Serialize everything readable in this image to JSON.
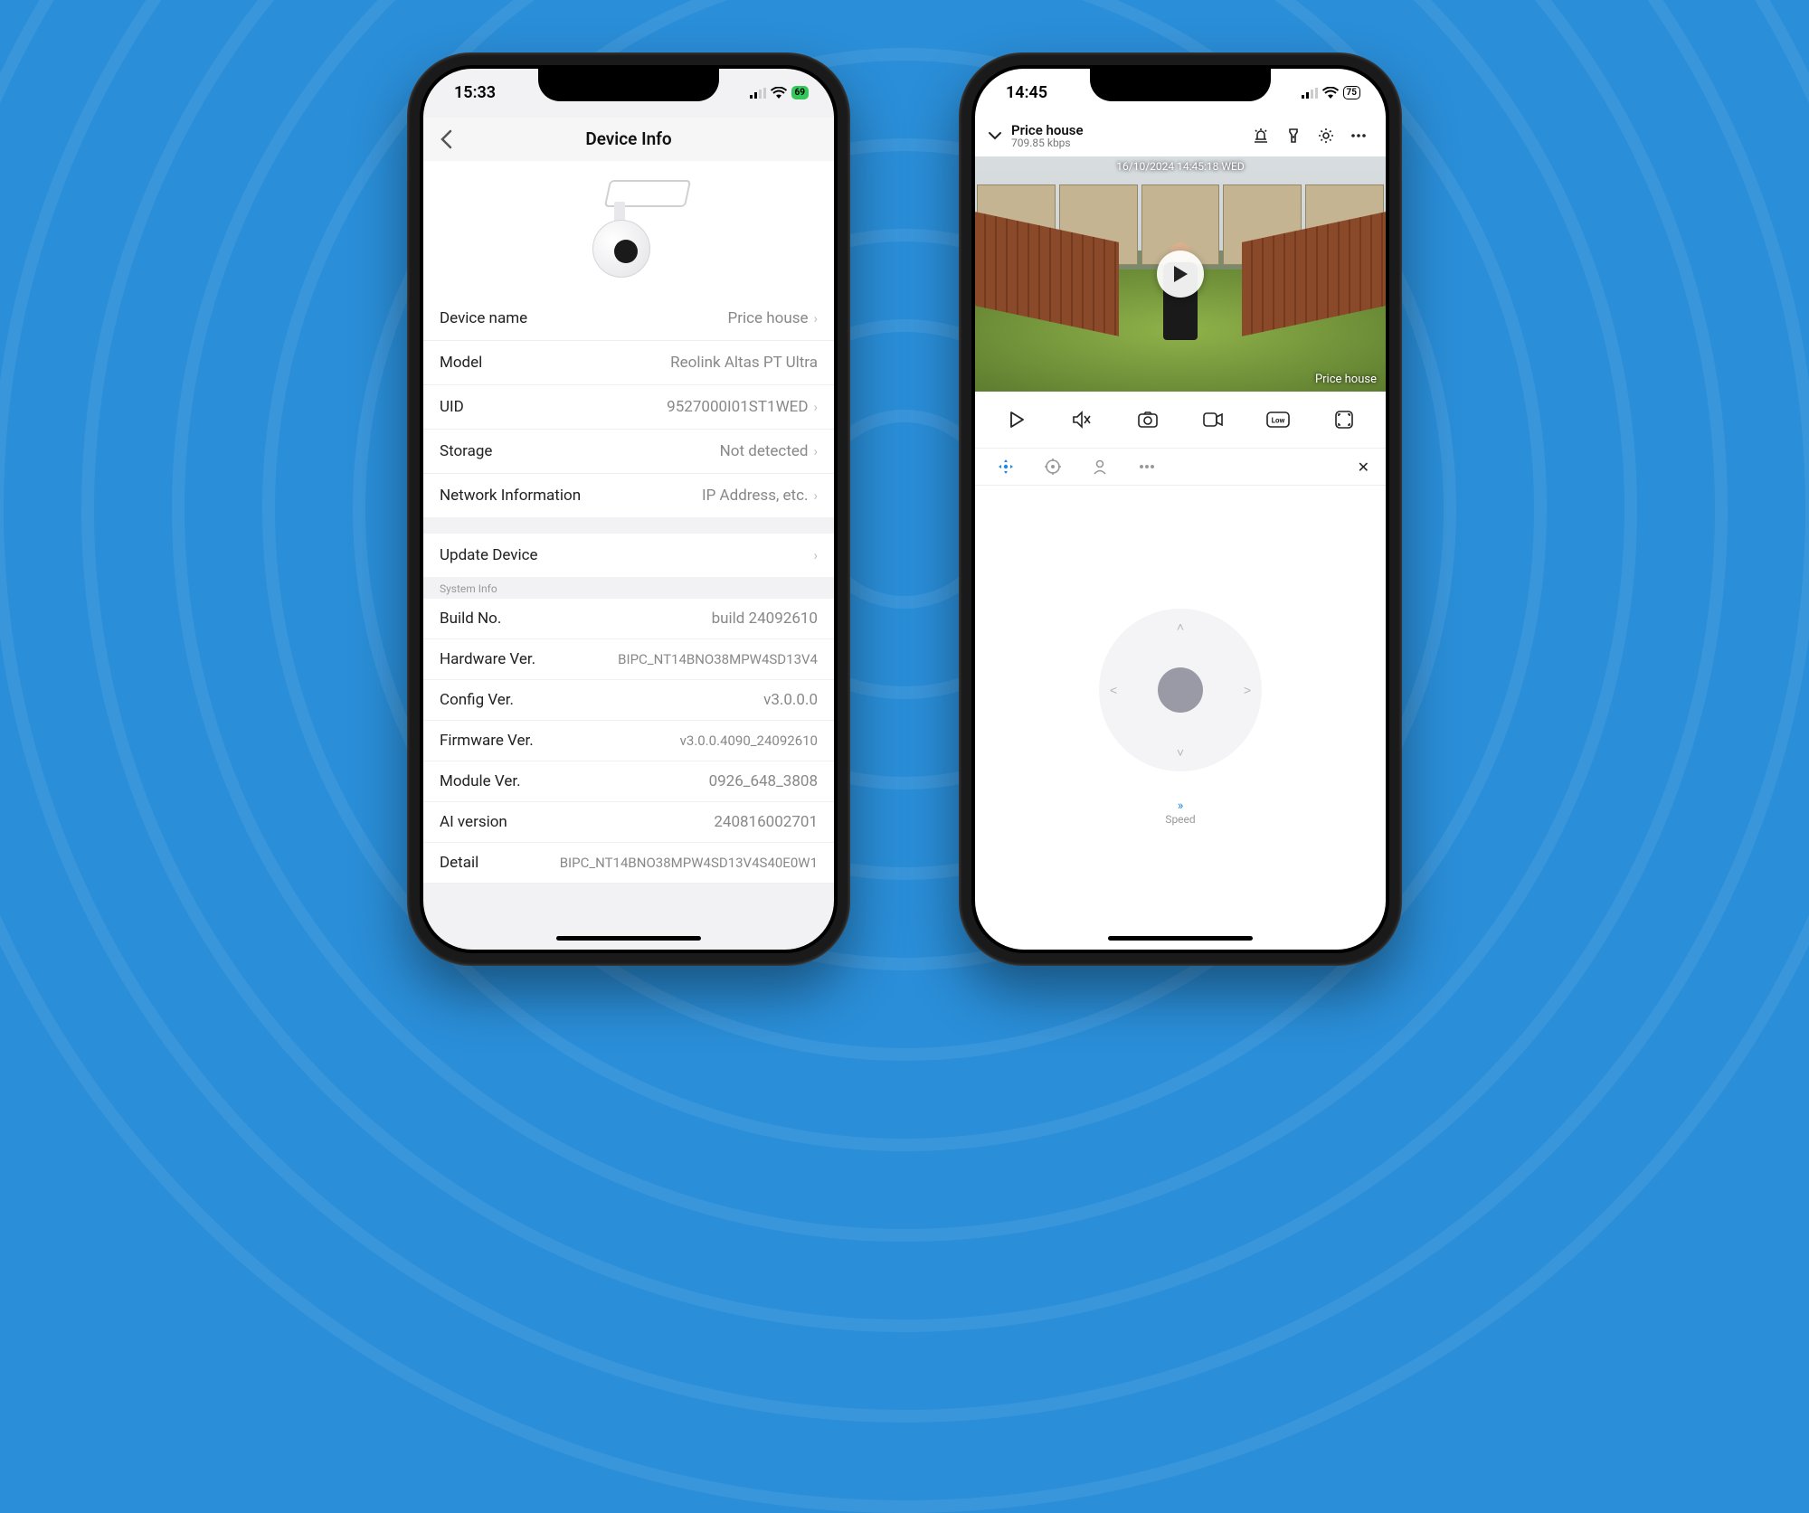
{
  "left": {
    "status": {
      "time": "15:33",
      "battery": "69"
    },
    "title": "Device Info",
    "rows": [
      {
        "label": "Device name",
        "value": "Price house"
      },
      {
        "label": "Model",
        "value": "Reolink Altas PT Ultra"
      },
      {
        "label": "UID",
        "value": "9527000I01ST1WED"
      },
      {
        "label": "Storage",
        "value": "Not detected"
      },
      {
        "label": "Network Information",
        "value": "IP Address, etc."
      }
    ],
    "update": {
      "label": "Update Device"
    },
    "system_header": "System Info",
    "system": [
      {
        "label": "Build No.",
        "value": "build 24092610"
      },
      {
        "label": "Hardware Ver.",
        "value": "BIPC_NT14BNO38MPW4SD13V4"
      },
      {
        "label": "Config Ver.",
        "value": "v3.0.0.0"
      },
      {
        "label": "Firmware Ver.",
        "value": "v3.0.0.4090_24092610"
      },
      {
        "label": "Module Ver.",
        "value": "0926_648_3808"
      },
      {
        "label": "AI version",
        "value": "240816002701"
      },
      {
        "label": "Detail",
        "value": "BIPC_NT14BNO38MPW4SD13V4S40E0W1"
      }
    ]
  },
  "right": {
    "status": {
      "time": "14:45",
      "battery": "75"
    },
    "camera_name": "Price house",
    "bitrate": "709.85 kbps",
    "overlay_timestamp": "16/10/2024 14:45:18 WED",
    "overlay_name": "Price house",
    "speed_label": "Speed"
  }
}
